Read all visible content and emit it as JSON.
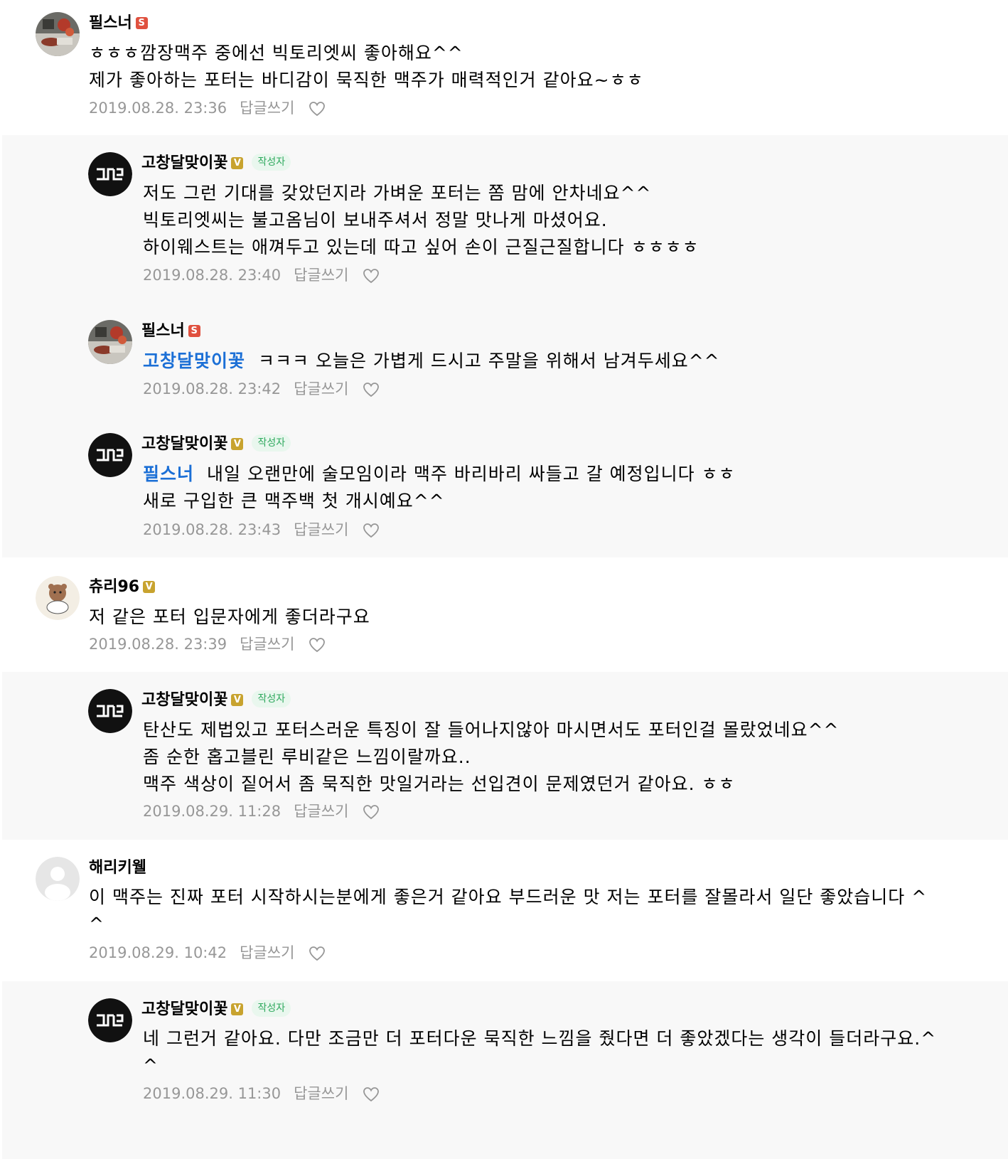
{
  "ui": {
    "reply_label": "답글쓰기",
    "author_tag": "작성자",
    "badge_s": "S",
    "badge_v": "V",
    "heart_icon": "heart-outline-icon",
    "colors": {
      "mention": "#1b6fd6",
      "meta": "#979797",
      "reply_bg": "#f8f8f8",
      "author_tag": "#2fa95e"
    }
  },
  "comments": [
    {
      "nickname": "필스너",
      "badge": "S",
      "is_author": false,
      "avatar": "food-photo",
      "lines": [
        "ㅎㅎㅎ깜장맥주 중에선 빅토리엣씨 좋아해요^^",
        "제가 좋아하는 포터는 바디감이 묵직한 맥주가 매력적인거 같아요~ㅎㅎ"
      ],
      "date": "2019.08.28. 23:36"
    },
    {
      "nickname": "고창달맞이꽃",
      "badge": "V",
      "is_author": true,
      "avatar": "logo",
      "lines": [
        "저도 그런 기대를 갖았던지라 가벼운 포터는 쫌 맘에 안차네요^^",
        "빅토리엣씨는 불고옴님이 보내주셔서 정말 맛나게 마셨어요.",
        "하이웨스트는 애껴두고 있는데 따고 싶어 손이 근질근질합니다 ㅎㅎㅎㅎ"
      ],
      "date": "2019.08.28. 23:40"
    },
    {
      "nickname": "필스너",
      "badge": "S",
      "is_author": false,
      "avatar": "food-photo",
      "mention": "고창달맞이꽃",
      "lines": [
        "ㅋㅋㅋ 오늘은 가볍게 드시고 주말을 위해서 남겨두세요^^"
      ],
      "date": "2019.08.28. 23:42"
    },
    {
      "nickname": "고창달맞이꽃",
      "badge": "V",
      "is_author": true,
      "avatar": "logo",
      "mention": "필스너",
      "lines": [
        "내일 오랜만에 술모임이라 맥주 바리바리 싸들고 갈 예정입니다 ㅎㅎ",
        "새로 구입한 큰 맥주백 첫 개시예요^^"
      ],
      "date": "2019.08.28. 23:43"
    },
    {
      "nickname": "츄리96",
      "badge": "V",
      "is_author": false,
      "avatar": "bear",
      "lines": [
        "저 같은 포터 입문자에게 좋더라구요"
      ],
      "date": "2019.08.28. 23:39"
    },
    {
      "nickname": "고창달맞이꽃",
      "badge": "V",
      "is_author": true,
      "avatar": "logo",
      "lines": [
        "탄산도 제법있고 포터스러운 특징이 잘 들어나지않아 마시면서도 포터인걸 몰랐었네요^^",
        "좀 순한 홉고블린 루비같은 느낌이랄까요..",
        "맥주 색상이 짙어서 좀 묵직한 맛일거라는 선입견이 문제였던거 같아요. ㅎㅎ"
      ],
      "date": "2019.08.29. 11:28"
    },
    {
      "nickname": "해리키웰",
      "badge": "",
      "is_author": false,
      "avatar": "default",
      "lines": [
        "이 맥주는 진짜 포터 시작하시는분에게 좋은거 같아요 부드러운 맛 저는 포터를 잘몰라서 일단 좋았습니다 ^",
        "^"
      ],
      "date": "2019.08.29. 10:42"
    },
    {
      "nickname": "고창달맞이꽃",
      "badge": "V",
      "is_author": true,
      "avatar": "logo",
      "lines": [
        "네 그런거 같아요. 다만 조금만 더 포터다운 묵직한 느낌을 줬다면 더 좋았겠다는 생각이 들더라구요.^",
        "^"
      ],
      "date": "2019.08.29. 11:30"
    }
  ]
}
